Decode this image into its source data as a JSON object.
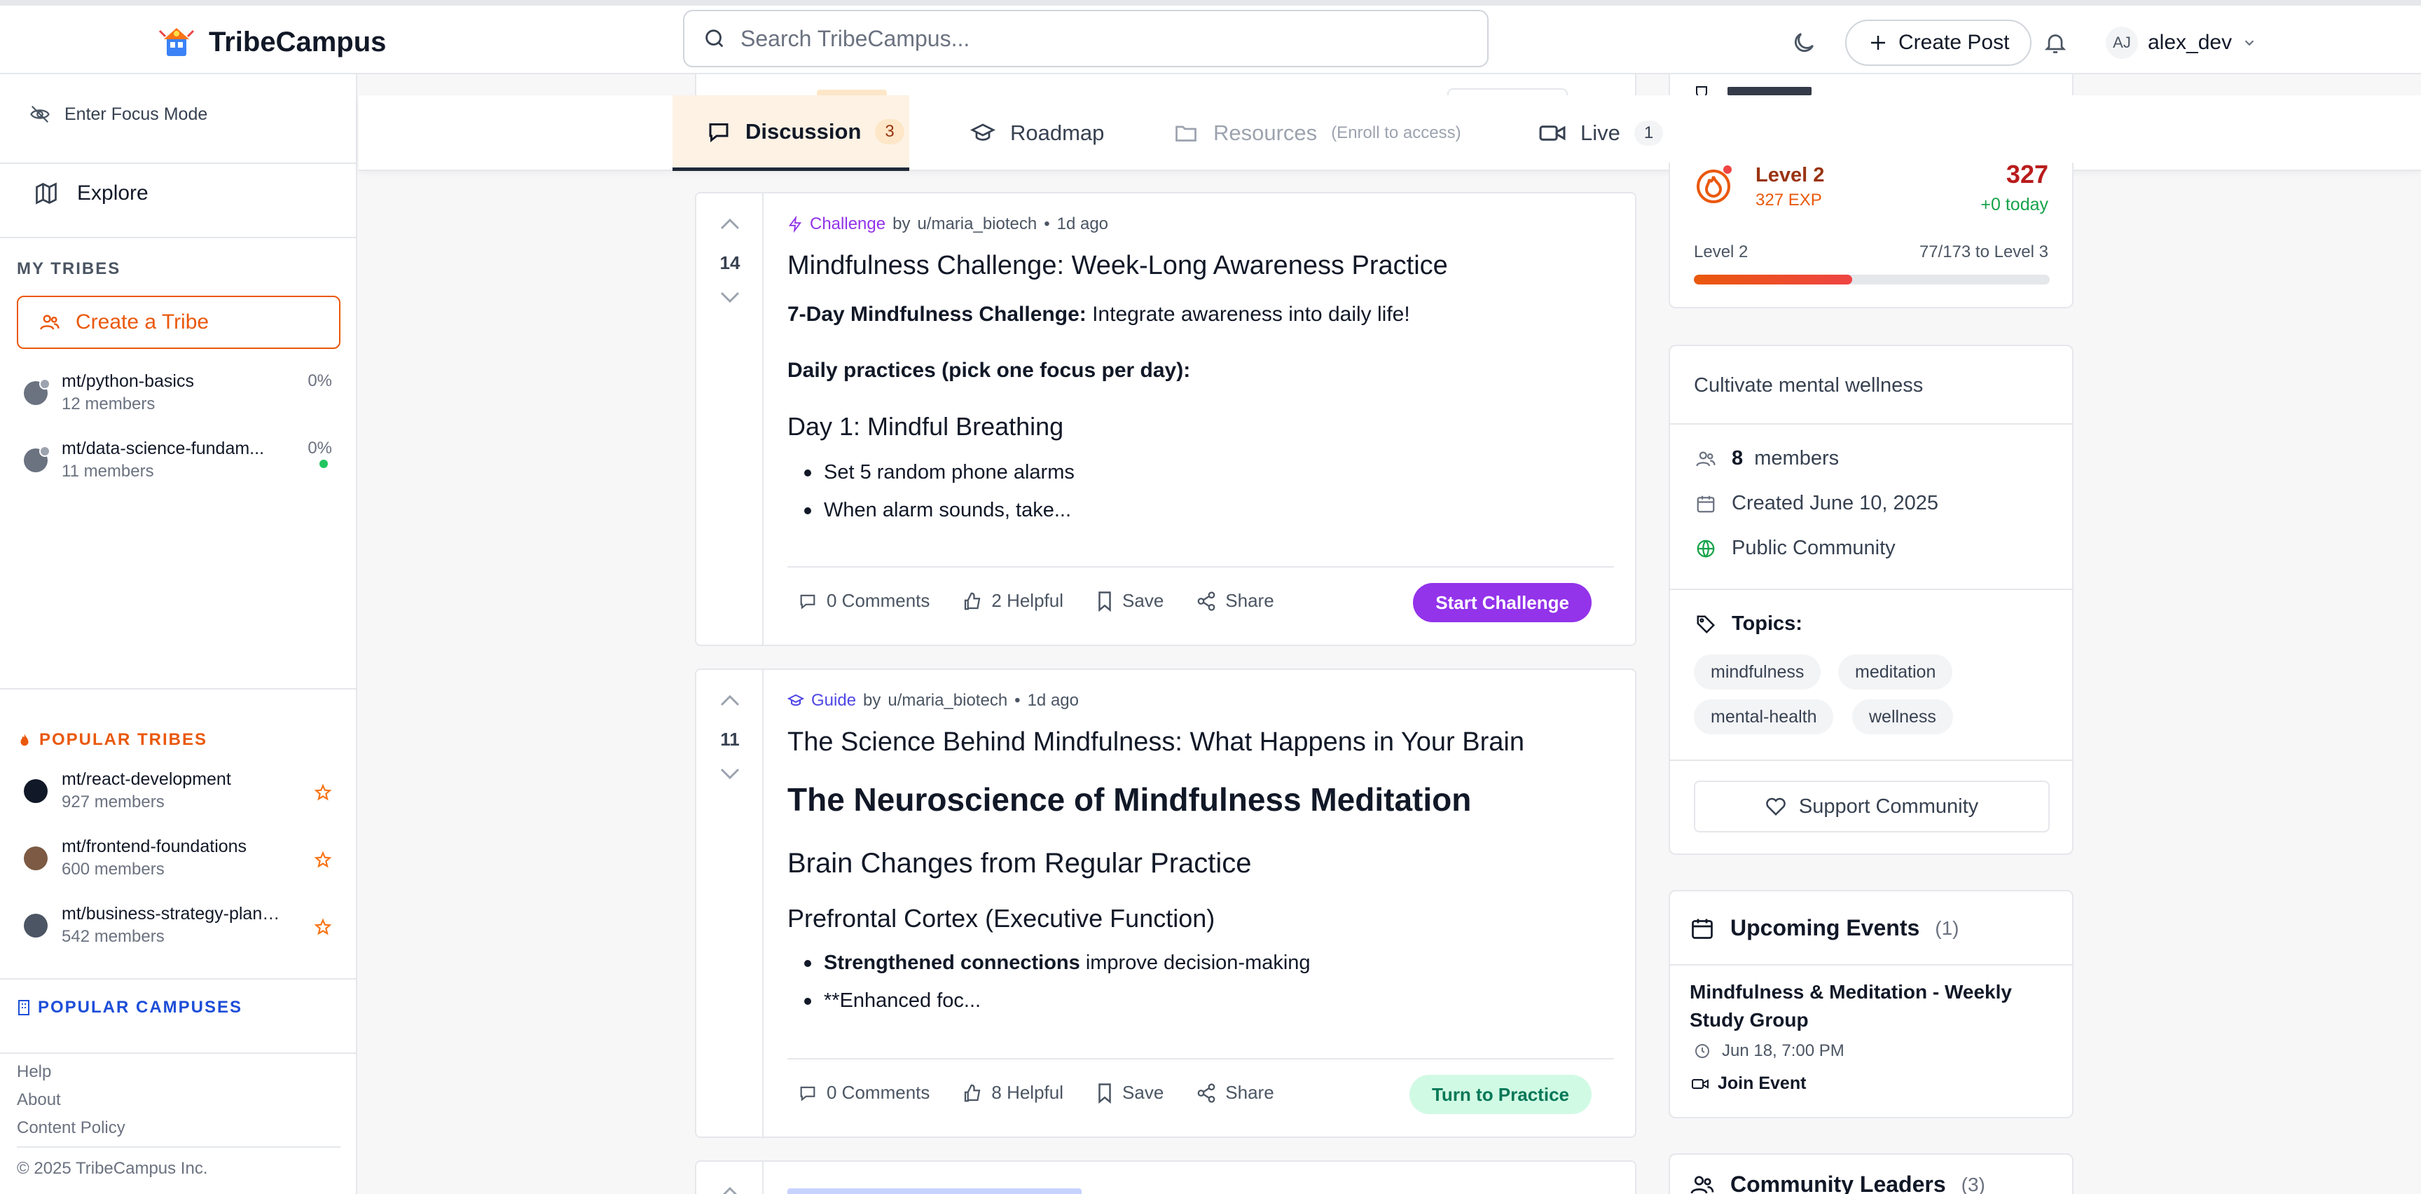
{
  "header": {
    "app_name": "TribeCampus",
    "search_placeholder": "Search TribeCampus...",
    "create_post_label": "Create Post",
    "user_initials": "AJ",
    "username": "alex_dev"
  },
  "sidebar": {
    "focus_mode_label": "Enter Focus Mode",
    "explore_label": "Explore",
    "my_tribes_title": "MY TRIBES",
    "create_tribe_label": "Create a Tribe",
    "my_tribes": [
      {
        "name": "mt/python-basics",
        "members": "12 members",
        "progress": "0%"
      },
      {
        "name": "mt/data-science-fundam...",
        "members": "11 members",
        "progress": "0%"
      }
    ],
    "popular_tribes_title": "POPULAR TRIBES",
    "popular_tribes": [
      {
        "name": "mt/react-development",
        "members": "927 members"
      },
      {
        "name": "mt/frontend-foundations",
        "members": "600 members"
      },
      {
        "name": "mt/business-strategy-planni...",
        "members": "542 members"
      }
    ],
    "popular_campuses_title": "POPULAR CAMPUSES",
    "footer_links": [
      "Help",
      "About",
      "Content Policy"
    ],
    "copyright": "© 2025 TribeCampus Inc."
  },
  "tabs": [
    {
      "label": "Discussion",
      "count": "3"
    },
    {
      "label": "Roadmap"
    },
    {
      "label": "Resources",
      "note": "(Enroll to access)"
    },
    {
      "label": "Live",
      "count": "1"
    }
  ],
  "posts": [
    {
      "votes": "14",
      "type": "Challenge",
      "by": "by",
      "author": "u/maria_biotech",
      "time": "1d ago",
      "title": "Mindfulness Challenge: Week-Long Awareness Practice",
      "intro_bold": "7-Day Mindfulness Challenge:",
      "intro_rest": " Integrate awareness into daily life!",
      "subheading": "Daily practices (pick one focus per day):",
      "day_heading": "Day 1: Mindful Breathing",
      "bullets": [
        "Set 5 random phone alarms",
        "When alarm sounds, take..."
      ],
      "comments": "0 Comments",
      "helpful": "2 Helpful",
      "save": "Save",
      "share": "Share",
      "cta": "Start Challenge"
    },
    {
      "votes": "11",
      "type": "Guide",
      "by": "by",
      "author": "u/maria_biotech",
      "time": "1d ago",
      "title": "The Science Behind Mindfulness: What Happens in Your Brain",
      "h1": "The Neuroscience of Mindfulness Meditation",
      "h2": "Brain Changes from Regular Practice",
      "h3": "Prefrontal Cortex (Executive Function)",
      "bullet1_bold": "Strengthened connections",
      "bullet1_rest": " improve decision-making",
      "bullet2": "**Enhanced foc...",
      "comments": "0 Comments",
      "helpful": "8 Helpful",
      "save": "Save",
      "share": "Share",
      "cta": "Turn to Practice"
    }
  ],
  "level_card": {
    "level": "Level 2",
    "exp": "327 EXP",
    "points": "327",
    "today": "+0 today",
    "progress_label": "Level 2",
    "progress_text": "77/173 to Level 3",
    "progress_fraction": 0.445
  },
  "about_card": {
    "description": "Cultivate mental wellness",
    "members_count": "8",
    "members_label": "members",
    "created": "Created June 10, 2025",
    "visibility": "Public Community",
    "topics_title": "Topics:",
    "topics": [
      "mindfulness",
      "meditation",
      "mental-health",
      "wellness"
    ],
    "support_label": "Support Community"
  },
  "events_card": {
    "title": "Upcoming Events",
    "count": "(1)",
    "event_title_line1": "Mindfulness & Meditation - Weekly",
    "event_title_line2": "Study Group",
    "event_time": "Jun 18, 7:00 PM",
    "join_label": "Join Event"
  },
  "leaders_card": {
    "title": "Community Leaders",
    "count": "(3)"
  },
  "colors": {
    "accent_orange": "#ea580c",
    "challenge_purple": "#9333ea",
    "guide_indigo": "#4f46e5",
    "campus_blue": "#1d4ed8",
    "practice_green": "#d1fae5"
  }
}
